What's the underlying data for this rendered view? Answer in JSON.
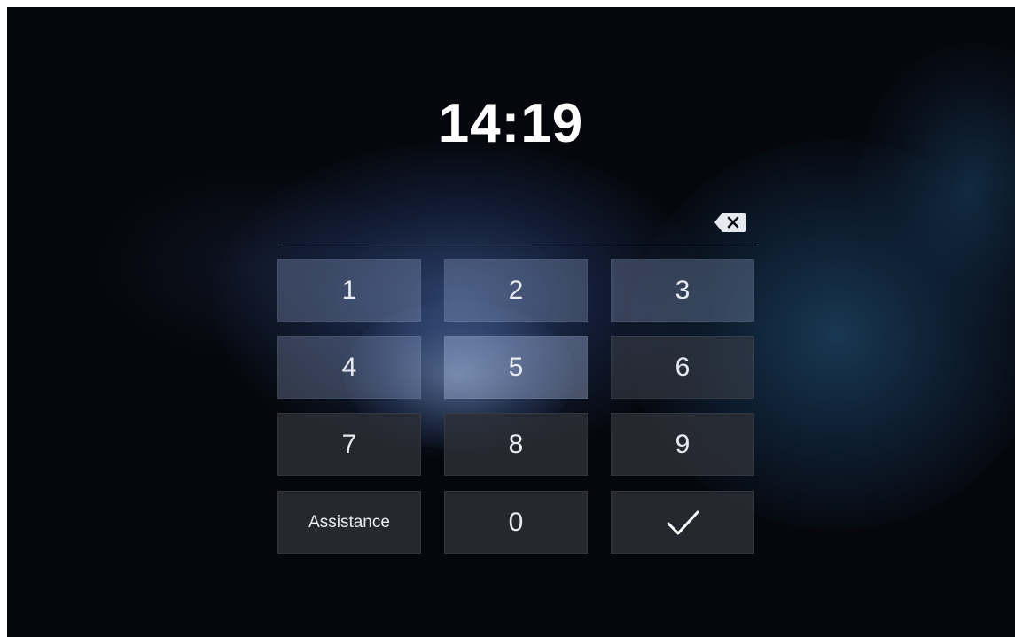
{
  "clock": {
    "time": "14:19"
  },
  "pin_entry": {
    "value": "",
    "backspace_icon": "backspace-icon"
  },
  "keypad": {
    "keys": [
      "1",
      "2",
      "3",
      "4",
      "5",
      "6",
      "7",
      "8",
      "9"
    ],
    "assistance_label": "Assistance",
    "zero_label": "0",
    "confirm_icon": "checkmark-icon"
  }
}
